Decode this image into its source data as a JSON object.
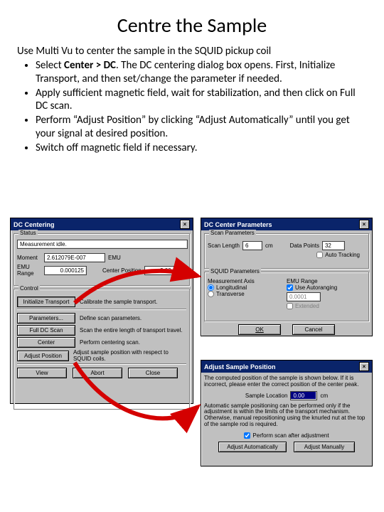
{
  "title": "Centre the Sample",
  "intro": "Use Multi Vu to center the sample in the SQUID pickup coil",
  "bullets": [
    "Select <b>Center > DC</b>. The DC centering dialog box opens. First, Initialize Transport, and then set/change the parameter if needed.",
    "Apply sufficient magnetic field, wait for stabilization, and then click on Full DC scan.",
    "Perform “Adjust Position” by clicking “Adjust Automatically” until you get your signal at desired position.",
    "Switch off magnetic field if necessary."
  ],
  "dc_centering": {
    "title": "DC Centering",
    "status_group": "Status",
    "status_text": "Measurement idle.",
    "moment_label": "Moment",
    "moment_value": "2.612079E-007",
    "moment_unit": "EMU",
    "range_label": "EMU Range",
    "range_value": "0.000125",
    "center_label": "Center Position",
    "center_value": "3.00",
    "center_unit": "cm",
    "control_group": "Control",
    "buttons": {
      "init": "Initialize Transport",
      "init_desc": "Calibrate the sample transport.",
      "params": "Parameters...",
      "params_desc": "Define scan parameters.",
      "full": "Full DC Scan",
      "full_desc": "Scan the entire length of transport travel.",
      "center": "Center",
      "center_desc": "Perform centering scan.",
      "adjust": "Adjust Position",
      "adjust_desc": "Adjust sample position with respect to SQUID coils.",
      "view": "View",
      "abort": "Abort",
      "close": "Close"
    }
  },
  "dc_params": {
    "title": "DC Center Parameters",
    "scan_group": "Scan Parameters",
    "scan_length_label": "Scan Length",
    "scan_length_value": "6",
    "scan_length_unit": "cm",
    "data_points_label": "Data Points",
    "data_points_value": "32",
    "auto_tracking": "Auto Tracking",
    "squid_group": "SQUID Parameters",
    "axis_label": "Measurement Axis",
    "radio_long": "Longitudinal",
    "radio_trans": "Transverse",
    "emu_label": "EMU Range",
    "use_auto": "Use Autoranging",
    "emu_val": "0.0001",
    "extended": "Extended",
    "ok": "OK",
    "cancel": "Cancel"
  },
  "adjust": {
    "title": "Adjust Sample Position",
    "desc1": "The computed position of the sample is shown below.  If it is incorrect, please enter the correct position of the center peak.",
    "loc_label": "Sample Location",
    "loc_value": "0.00",
    "loc_unit": "cm",
    "desc2": "Automatic sample positioning can be performed only if the adjustment is within the limits of the transport mechanism. Otherwise, manual repositioning using the knurled nut at the top of the sample rod is required.",
    "perform_scan": "Perform scan after adjustment",
    "btn_auto": "Adjust Automatically",
    "btn_manual": "Adjust Manually"
  }
}
